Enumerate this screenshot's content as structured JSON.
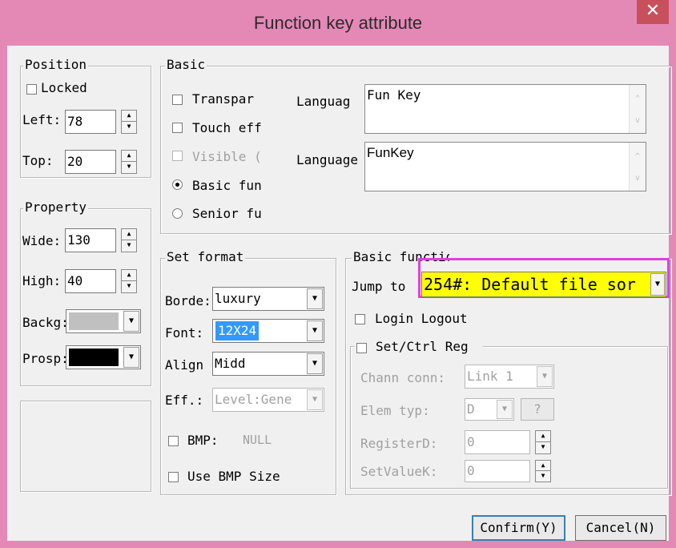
{
  "window": {
    "title": "Function key attribute",
    "close_glyph": "✕"
  },
  "position": {
    "legend": "Position",
    "locked_label": "Locked",
    "left_label": "Left:",
    "left_value": "78",
    "top_label": "Top:",
    "top_value": "20"
  },
  "property": {
    "legend": "Property",
    "wide_label": "Wide:",
    "wide_value": "130",
    "high_label": "High:",
    "high_value": "40",
    "backg_label": "Backg:",
    "backg_color": "#c0c0c0",
    "prosp_label": "Prosp:",
    "prosp_color": "#000000"
  },
  "basic": {
    "legend": "Basic",
    "transpar_label": "Transpar",
    "touch_label": "Touch eff",
    "visible_label": "Visible (",
    "basic_fun_label": "Basic fun",
    "senior_fu_label": "Senior fu",
    "language1_label": "Languag",
    "language1_value": "Fun Key",
    "language2_label": "Language",
    "language2_value": "FunKey"
  },
  "set_format": {
    "legend": "Set format",
    "border_label": "Borde:",
    "border_value": "luxury",
    "font_label": "Font:",
    "font_value": "12X24",
    "align_label": "Align",
    "align_value": "Midd",
    "eff_label": "Eff.:",
    "eff_value": "Level:Gene",
    "bmp_label": "BMP:",
    "bmp_value": "NULL",
    "use_bmp_size_label": "Use BMP Size"
  },
  "basic_function": {
    "legend": "Basic function",
    "jump_label": "Jump to",
    "jump_value": "254#: Default file sor",
    "login_logout_label": "Login Logout",
    "set_ctrl_reg_label": "Set/Ctrl Reg",
    "chann_conn_label": "Chann conn:",
    "chann_conn_value": "Link 1",
    "elem_typ_label": "Elem typ:",
    "elem_typ_value": "D",
    "elem_typ_help": "?",
    "register_label": "RegisterD:",
    "register_value": "0",
    "setvalue_label": "SetValueK:",
    "setvalue_value": "0"
  },
  "buttons": {
    "confirm": "Confirm(Y)",
    "cancel": "Cancel(N)"
  },
  "colors": {
    "title_bar": "#e488b6",
    "highlight_border": "#e040e0",
    "highlight_fill": "#ffff00",
    "selection": "#3399ff"
  }
}
